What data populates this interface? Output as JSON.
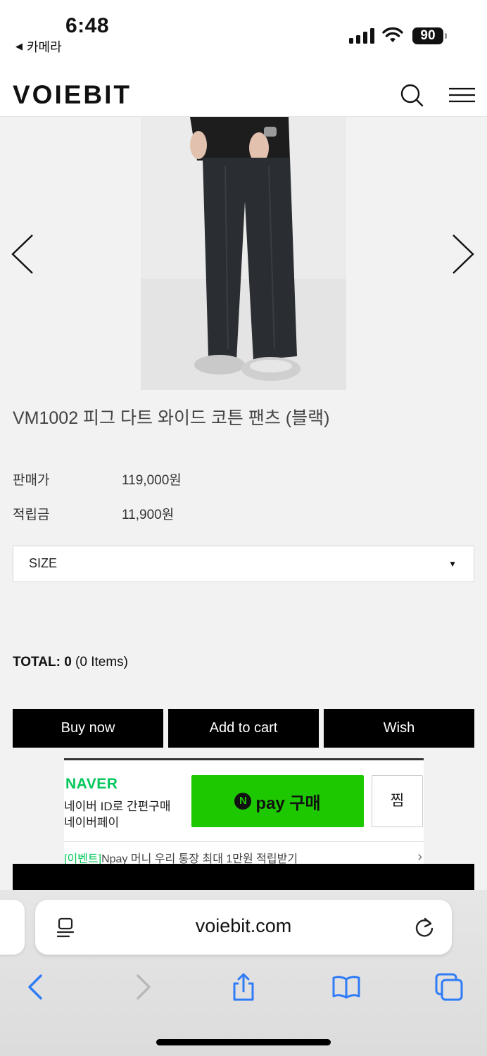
{
  "status": {
    "time": "6:48",
    "back_app": "카메라",
    "battery": "90"
  },
  "header": {
    "logo": "VOIEBIT"
  },
  "product": {
    "title": "VM1002 피그 다트 와이드 코튼 팬츠 (블랙)",
    "price_label": "판매가",
    "price_value": "119,000원",
    "points_label": "적립금",
    "points_value": "11,900원",
    "size_placeholder": "SIZE",
    "total_label": "TOTAL:",
    "total_value": "0",
    "total_items": "(0 Items)"
  },
  "buttons": {
    "buy_now": "Buy now",
    "add_to_cart": "Add to cart",
    "wish": "Wish"
  },
  "npay": {
    "brand": "NAVER",
    "desc_line1": "네이버 ID로 간편구매",
    "desc_line2": "네이버페이",
    "pay_label": "pay 구매",
    "n_mark": "N",
    "zzim": "찜",
    "event_tag": "[이벤트]",
    "event_text": "Npay 머니 우리 통장 최대 1만원 적립받기"
  },
  "safari": {
    "url": "voiebit.com"
  },
  "colors": {
    "naver_green": "#03c75a",
    "npay_button": "#1ec800",
    "ios_blue": "#2f7cf6",
    "button_black": "#000000"
  }
}
